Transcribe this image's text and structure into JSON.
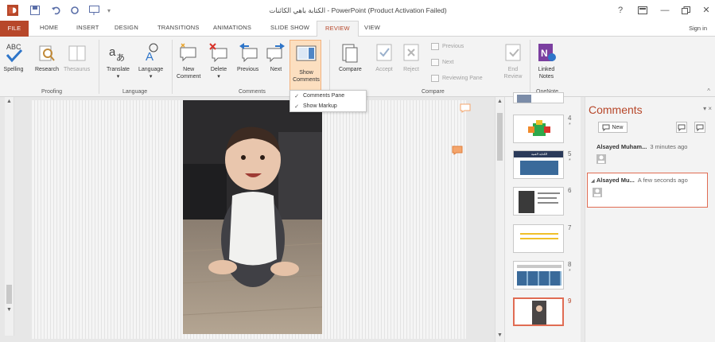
{
  "window": {
    "title": "الكتابة باهي الكائنات - PowerPoint (Product Activation Failed)",
    "help": "?",
    "minimize": "—",
    "close": "✕"
  },
  "tabs": {
    "file": "FILE",
    "items": [
      "HOME",
      "INSERT",
      "DESIGN",
      "TRANSITIONS",
      "ANIMATIONS",
      "SLIDE SHOW",
      "REVIEW",
      "VIEW"
    ],
    "active": "REVIEW",
    "sign_in": "Sign in"
  },
  "ribbon": {
    "proofing": {
      "label": "Proofing",
      "spelling": "Spelling",
      "abc": "ABC",
      "research": "Research",
      "thesaurus": "Thesaurus"
    },
    "language": {
      "label": "Language",
      "translate": "Translate",
      "language": "Language"
    },
    "comments": {
      "label": "Comments",
      "new": "New\nComment",
      "delete": "Delete",
      "previous": "Previous",
      "next": "Next",
      "show": "Show\nComments"
    },
    "compare": {
      "label": "Compare",
      "compare": "Compare",
      "accept": "Accept",
      "reject": "Reject",
      "prev": "Previous",
      "next": "Next",
      "reviewing_pane": "Reviewing Pane",
      "end_review": "End\nReview"
    },
    "onenote": {
      "label": "OneNote",
      "linked_notes": "Linked\nNotes"
    }
  },
  "dropdown": {
    "items": [
      {
        "check": "✓",
        "label": "Comments Pane"
      },
      {
        "check": "✓",
        "label": "Show Markup"
      }
    ]
  },
  "thumbnails": {
    "numbers": [
      "4",
      "5",
      "6",
      "7",
      "8",
      "9"
    ],
    "star": "*",
    "slide5_banner": "الكتابة الفنية"
  },
  "comments_pane": {
    "title": "Comments",
    "new_button": "New",
    "comment1": {
      "author": "Alsayed Muham...",
      "time": "3 minutes ago"
    },
    "comment2": {
      "author": "Alsayed Mu...",
      "time": "A few seconds ago"
    }
  },
  "colors": {
    "accent": "#b7472a",
    "highlight": "#fcdfc0",
    "comment_marker": "#f4a56c"
  }
}
